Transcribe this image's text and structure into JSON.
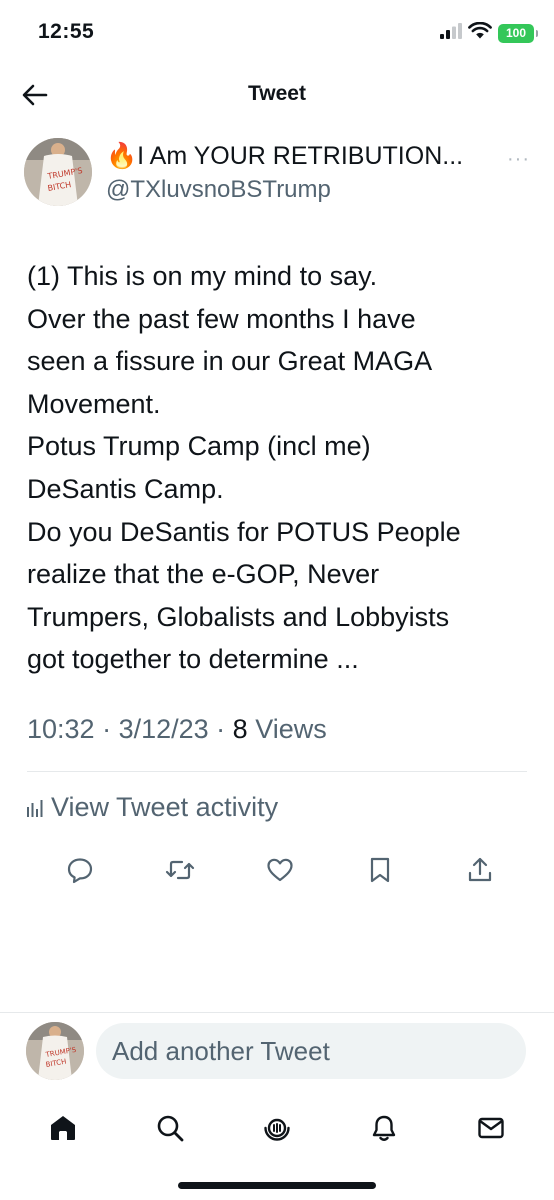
{
  "status": {
    "time": "12:55",
    "battery": "100",
    "battery_color": "#34c759"
  },
  "header": {
    "title": "Tweet",
    "back_icon": "arrow-left-icon"
  },
  "tweet": {
    "author_name": "🔥I Am YOUR RETRIBUTION...",
    "author_handle": "@TXluvsnoBSTrump",
    "more_label": "···",
    "lines": [
      "(1) This is on my mind to say.",
      "Over the past few months I have",
      "seen a fissure in our Great MAGA",
      "Movement.",
      "Potus Trump Camp (incl me)",
      "DeSantis Camp.",
      "Do you DeSantis for POTUS People",
      "realize that the e-GOP, Never",
      "Trumpers, Globalists and Lobbyists",
      "got together to determine ..."
    ],
    "time": "10:32",
    "sep1": " · ",
    "date": "3/12/23",
    "sep2": " · ",
    "views_count": "8",
    "views_label": " Views",
    "activity_label": "View Tweet activity"
  },
  "actions": [
    "reply-icon",
    "retweet-icon",
    "like-icon",
    "bookmark-icon",
    "share-icon"
  ],
  "reply": {
    "placeholder": "Add another Tweet"
  },
  "tabs": [
    "home-icon",
    "search-icon",
    "spaces-icon",
    "notifications-icon",
    "messages-icon"
  ],
  "colors": {
    "text": "#0f1419",
    "secondary": "#536471",
    "divider": "#e6e9eb",
    "input_bg": "#eff3f4"
  }
}
